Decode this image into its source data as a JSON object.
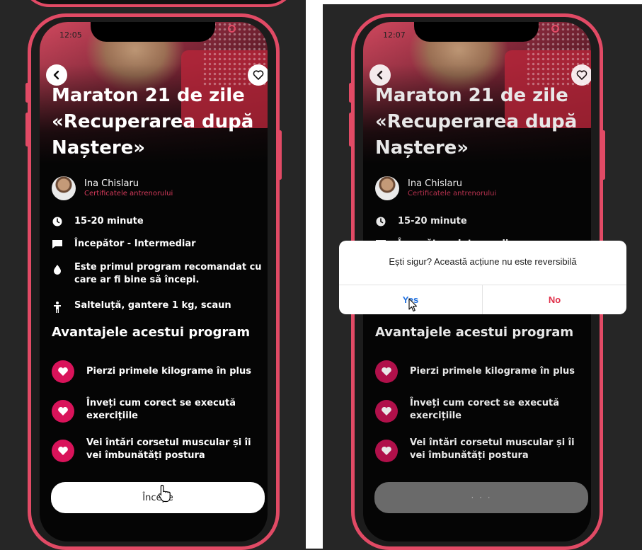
{
  "colors": {
    "accent": "#e14a65",
    "heart": "#d9135a",
    "trainer_link": "#d63a5b",
    "yes": "#1e6fe0",
    "no": "#e0304a"
  },
  "screen_a": {
    "time": "12:05",
    "title": "Maraton 21 de zile «Recuperarea după Naștere»",
    "trainer_name": "Ina Chislaru",
    "trainer_link": "Certificatele antrenorului",
    "duration": "15-20 minute",
    "level": "Începător - Intermediar",
    "recommendation": "Este primul program recomandat cu care ar fi bine să începi.",
    "equipment": "Salteluță, gantere 1 kg, scaun",
    "advantages_title": "Avantajele acestui program",
    "advantages": [
      "Pierzi primele kilograme în plus",
      "Înveți cum corect se execută exercițiile",
      "Vei întări corsetul muscular și îi vei îmbunătăți postura"
    ],
    "start_label": "Începe"
  },
  "screen_b": {
    "time": "12:07",
    "title": "Maraton 21 de zile «Recuperarea după Naștere»",
    "trainer_name": "Ina Chislaru",
    "trainer_link": "Certificatele antrenorului",
    "duration": "15-20 minute",
    "level": "Începător - Intermediar",
    "advantages_title": "Avantajele acestui program",
    "advantages": [
      "Pierzi primele kilograme în plus",
      "Înveți cum corect se execută exercițiile",
      "Vei întări corsetul muscular și îi vei îmbunătăți postura"
    ],
    "loading_label": "· · ·"
  },
  "dialog": {
    "message": "Ești sigur? Această acțiune nu este reversibilă",
    "yes": "Yes",
    "no": "No"
  },
  "icons": [
    "back-arrow-icon",
    "heart-outline-icon",
    "clock-icon",
    "chat-icon",
    "drop-icon",
    "person-icon",
    "heart-icon",
    "hand-cursor-icon",
    "arrow-cursor-icon"
  ]
}
